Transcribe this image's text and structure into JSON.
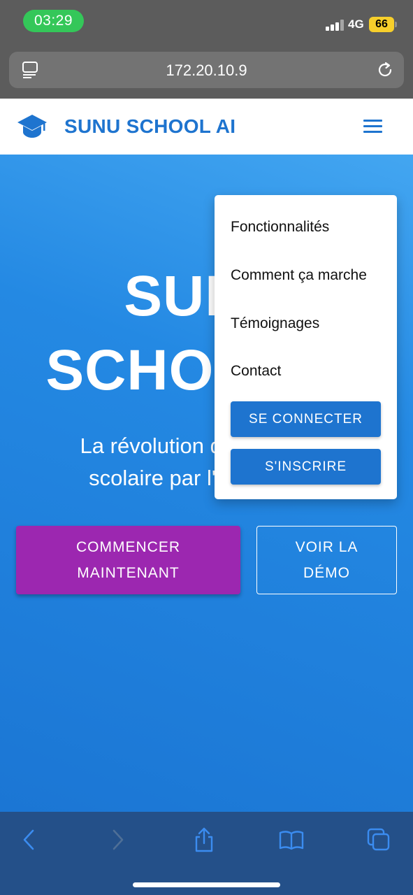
{
  "status_bar": {
    "time": "03:29",
    "network": "4G",
    "battery": "66"
  },
  "browser": {
    "url": "172.20.10.9"
  },
  "header": {
    "brand": "SUNU SCHOOL AI",
    "logo_icon": "graduation-cap-icon",
    "menu_icon": "hamburger-menu-icon",
    "accent_color": "#1e74cf"
  },
  "hero": {
    "title_line1": "SUNU",
    "title_line2": "SCHOOL AI",
    "subtitle_line1": "La révolution de la gestion",
    "subtitle_line2": "scolaire par l'intelligence",
    "primary_button_line1": "COMMENCER",
    "primary_button_line2": "MAINTENANT",
    "secondary_button_line1": "VOIR LA",
    "secondary_button_line2": "DÉMO",
    "primary_color": "#9c27b0"
  },
  "dropdown": {
    "items": [
      "Fonctionnalités",
      "Comment ça marche",
      "Témoignages",
      "Contact"
    ],
    "login_button": "SE CONNECTER",
    "signup_button": "S'INSCRIRE"
  },
  "toolbar": {
    "icons": [
      "back-icon",
      "forward-icon",
      "share-icon",
      "bookmarks-icon",
      "tabs-icon"
    ]
  }
}
